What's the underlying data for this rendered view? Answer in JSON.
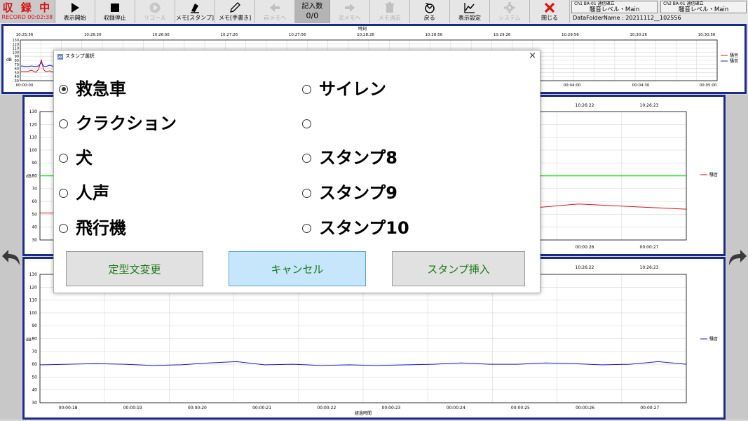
{
  "toolbar": {
    "status_title": "収 録 中",
    "status_time": "RECORD 00:02:38",
    "buttons": [
      {
        "label": "表示開始"
      },
      {
        "label": "収録停止"
      },
      {
        "label": "リコール"
      },
      {
        "label": "メモ[スタンプ]"
      },
      {
        "label": "メモ[手書き]"
      },
      {
        "label": "前メモへ"
      },
      {
        "label": "次メモへ"
      },
      {
        "label": "メモ消去"
      },
      {
        "label": "戻る"
      },
      {
        "label": "表示設定"
      },
      {
        "label": "システム"
      },
      {
        "label": "閉じる"
      }
    ],
    "memo_count_label": "記入数",
    "memo_count_value": "0/0"
  },
  "channels": [
    {
      "status": "Ch1 BA-01 通信確立",
      "name": "騒音レベル・Main"
    },
    {
      "status": "Ch2 BA-01 通信確立",
      "name": "騒音レベル・Main"
    }
  ],
  "data_folder": "DataFolderName : 20211112__102556",
  "overview": {
    "top_axis_label": "時刻",
    "top_ticks": [
      "10:25:56",
      "10:26:26",
      "10:26:56",
      "10:27:26",
      "10:27:56",
      "10:28:26",
      "10:28:56",
      "10:29:26",
      "10:29:56",
      "10:30:26",
      "10:30:56"
    ],
    "bottom_ticks": [
      "00:00:00",
      "00:04:00",
      "00:04:30",
      "00:05:00"
    ],
    "y_ticks": [
      "130",
      "120",
      "110",
      "100",
      "90",
      "80",
      "70",
      "60",
      "50",
      "40",
      "30"
    ],
    "ylabel": "dB",
    "legend": [
      "騒音",
      "騒音"
    ]
  },
  "chart1": {
    "top_ticks": [
      "10:26:22",
      "10:26:23"
    ],
    "bottom_ticks": [
      "00:00:26",
      "00:00:27"
    ],
    "y_ticks": [
      "130",
      "120",
      "110",
      "100",
      "90",
      "80",
      "70",
      "60",
      "50",
      "40",
      "30"
    ],
    "ylabel": "dB",
    "legend": "騒音"
  },
  "chart2": {
    "top_ticks": [
      "10:26:22",
      "10:26:23"
    ],
    "bottom_ticks": [
      "00:00:18",
      "00:00:19",
      "00:00:20",
      "00:00:21",
      "00:00:22",
      "00:00:23",
      "00:00:24",
      "00:00:25",
      "00:00:26",
      "00:00:27"
    ],
    "y_ticks": [
      "130",
      "120",
      "110",
      "100",
      "90",
      "80",
      "70",
      "60",
      "50",
      "40",
      "30"
    ],
    "ylabel": "dB",
    "xlabel": "経過時間",
    "legend": "騒音"
  },
  "dialog": {
    "title": "スタンプ選択",
    "close": "×",
    "options": [
      "救急車",
      "サイレン",
      "クラクション",
      "",
      "犬",
      "スタンプ8",
      "人声",
      "スタンプ9",
      "飛行機",
      "スタンプ10"
    ],
    "selected_index": 0,
    "btn_change": "定型文変更",
    "btn_cancel": "キャンセル",
    "btn_insert": "スタンプ挿入"
  },
  "colors": {
    "accent_border": "#1a2b8c",
    "record_red": "#e01010",
    "series_red": "#e01010",
    "series_blue": "#1c1cd0",
    "threshold_green": "#22dd22",
    "button_text_green": "#1a7a1a"
  },
  "chart_data": [
    {
      "type": "line",
      "ylabel": "dB",
      "ylim": [
        30,
        130
      ],
      "x": [
        "00:00:26",
        "00:00:27"
      ],
      "series": [
        {
          "name": "騒音",
          "values": [
            51,
            51,
            51,
            51,
            51,
            58,
            54
          ]
        }
      ],
      "threshold": 80
    },
    {
      "type": "line",
      "ylabel": "dB",
      "xlabel": "経過時間",
      "ylim": [
        30,
        130
      ],
      "x": [
        "00:00:18",
        "00:00:19",
        "00:00:20",
        "00:00:21",
        "00:00:22",
        "00:00:23",
        "00:00:24",
        "00:00:25",
        "00:00:26",
        "00:00:27"
      ],
      "series": [
        {
          "name": "騒音",
          "values": [
            59.5,
            60,
            60.5,
            60,
            59,
            59.5,
            61,
            62,
            59.5,
            60,
            59,
            59.5,
            59,
            59.5,
            60,
            61,
            60,
            60,
            61,
            60.5,
            59.5,
            60,
            62,
            60
          ]
        }
      ]
    }
  ]
}
